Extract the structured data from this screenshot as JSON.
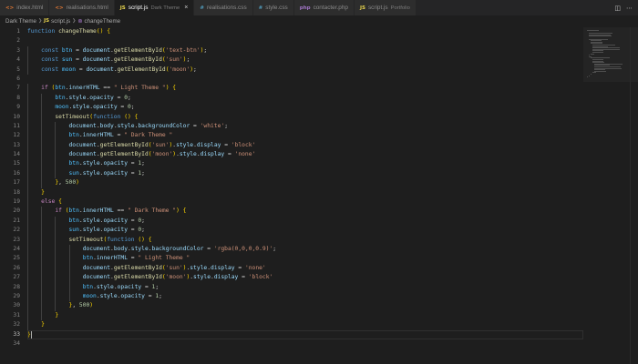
{
  "tabs": [
    {
      "label": "index.html",
      "icon": "html",
      "icon_text": "<>",
      "sub": "",
      "active": false
    },
    {
      "label": "realisations.html",
      "icon": "html",
      "icon_text": "<>",
      "sub": "",
      "active": false
    },
    {
      "label": "script.js",
      "icon": "js",
      "icon_text": "JS",
      "sub": "Dark Theme",
      "active": true
    },
    {
      "label": "realisations.css",
      "icon": "css",
      "icon_text": "#",
      "sub": "",
      "active": false
    },
    {
      "label": "style.css",
      "icon": "css",
      "icon_text": "#",
      "sub": "",
      "active": false
    },
    {
      "label": "contacter.php",
      "icon": "php",
      "icon_text": "php",
      "sub": "",
      "active": false
    },
    {
      "label": "script.js",
      "icon": "js",
      "icon_text": "JS",
      "sub": "Portfolio",
      "active": false
    }
  ],
  "tab_close": "×",
  "actions": [
    "split-editor-icon",
    "more-actions-icon"
  ],
  "breadcrumb": {
    "folder": "Dark Theme",
    "file_icon": "JS",
    "file": "script.js",
    "symbol_icon": "⊚",
    "symbol": "changeTheme"
  },
  "editor": {
    "active_line": 33,
    "lines": [
      {
        "n": 1,
        "indent": 0,
        "t": [
          [
            "kw",
            "function "
          ],
          [
            "fn",
            "changeTheme"
          ],
          [
            "br",
            "() {"
          ]
        ]
      },
      {
        "n": 2,
        "indent": 0,
        "t": []
      },
      {
        "n": 3,
        "indent": 1,
        "t": [
          [
            "kw",
            "const "
          ],
          [
            "con",
            "btn"
          ],
          [
            "pn",
            " = "
          ],
          [
            "var",
            "document"
          ],
          [
            "pn",
            "."
          ],
          [
            "fn",
            "getElementById"
          ],
          [
            "br",
            "("
          ],
          [
            "str",
            "'text-btn'"
          ],
          [
            "br",
            ")"
          ],
          [
            "pn",
            ";"
          ]
        ]
      },
      {
        "n": 4,
        "indent": 1,
        "t": [
          [
            "kw",
            "const "
          ],
          [
            "con",
            "sun"
          ],
          [
            "pn",
            " = "
          ],
          [
            "var",
            "document"
          ],
          [
            "pn",
            "."
          ],
          [
            "fn",
            "getElementById"
          ],
          [
            "br",
            "("
          ],
          [
            "str",
            "'sun'"
          ],
          [
            "br",
            ")"
          ],
          [
            "pn",
            ";"
          ]
        ]
      },
      {
        "n": 5,
        "indent": 1,
        "t": [
          [
            "kw",
            "const "
          ],
          [
            "con",
            "moon"
          ],
          [
            "pn",
            " = "
          ],
          [
            "var",
            "document"
          ],
          [
            "pn",
            "."
          ],
          [
            "fn",
            "getElementById"
          ],
          [
            "br",
            "("
          ],
          [
            "str",
            "'moon'"
          ],
          [
            "br",
            ")"
          ],
          [
            "pn",
            ";"
          ]
        ]
      },
      {
        "n": 6,
        "indent": 0,
        "t": []
      },
      {
        "n": 7,
        "indent": 1,
        "t": [
          [
            "ctl",
            "if "
          ],
          [
            "br",
            "("
          ],
          [
            "con",
            "btn"
          ],
          [
            "pn",
            "."
          ],
          [
            "var",
            "innerHTML"
          ],
          [
            "pn",
            " == "
          ],
          [
            "str",
            "\" Light Theme \""
          ],
          [
            "br",
            ")"
          ],
          [
            "pn",
            " "
          ],
          [
            "br",
            "{"
          ]
        ]
      },
      {
        "n": 8,
        "indent": 2,
        "t": [
          [
            "con",
            "btn"
          ],
          [
            "pn",
            "."
          ],
          [
            "var",
            "style"
          ],
          [
            "pn",
            "."
          ],
          [
            "var",
            "opacity"
          ],
          [
            "pn",
            " = "
          ],
          [
            "num",
            "0"
          ],
          [
            "pn",
            ";"
          ]
        ]
      },
      {
        "n": 9,
        "indent": 2,
        "t": [
          [
            "con",
            "moon"
          ],
          [
            "pn",
            "."
          ],
          [
            "var",
            "style"
          ],
          [
            "pn",
            "."
          ],
          [
            "var",
            "opacity"
          ],
          [
            "pn",
            " = "
          ],
          [
            "num",
            "0"
          ],
          [
            "pn",
            ";"
          ]
        ]
      },
      {
        "n": 10,
        "indent": 2,
        "t": [
          [
            "fn",
            "setTimeout"
          ],
          [
            "br",
            "("
          ],
          [
            "kw",
            "function "
          ],
          [
            "br",
            "() {"
          ]
        ]
      },
      {
        "n": 11,
        "indent": 3,
        "t": [
          [
            "var",
            "document"
          ],
          [
            "pn",
            "."
          ],
          [
            "var",
            "body"
          ],
          [
            "pn",
            "."
          ],
          [
            "var",
            "style"
          ],
          [
            "pn",
            "."
          ],
          [
            "var",
            "backgroundColor"
          ],
          [
            "pn",
            " = "
          ],
          [
            "str",
            "'white'"
          ],
          [
            "pn",
            ";"
          ]
        ]
      },
      {
        "n": 12,
        "indent": 3,
        "t": [
          [
            "con",
            "btn"
          ],
          [
            "pn",
            "."
          ],
          [
            "var",
            "innerHTML"
          ],
          [
            "pn",
            " = "
          ],
          [
            "str",
            "\" Dark Theme \""
          ]
        ]
      },
      {
        "n": 13,
        "indent": 3,
        "t": [
          [
            "var",
            "document"
          ],
          [
            "pn",
            "."
          ],
          [
            "fn",
            "getElementById"
          ],
          [
            "br",
            "("
          ],
          [
            "str",
            "'sun'"
          ],
          [
            "br",
            ")"
          ],
          [
            "pn",
            "."
          ],
          [
            "var",
            "style"
          ],
          [
            "pn",
            "."
          ],
          [
            "var",
            "display"
          ],
          [
            "pn",
            " = "
          ],
          [
            "str",
            "'block'"
          ]
        ]
      },
      {
        "n": 14,
        "indent": 3,
        "t": [
          [
            "var",
            "document"
          ],
          [
            "pn",
            "."
          ],
          [
            "fn",
            "getElementById"
          ],
          [
            "br",
            "("
          ],
          [
            "str",
            "'moon'"
          ],
          [
            "br",
            ")"
          ],
          [
            "pn",
            "."
          ],
          [
            "var",
            "style"
          ],
          [
            "pn",
            "."
          ],
          [
            "var",
            "display"
          ],
          [
            "pn",
            " = "
          ],
          [
            "str",
            "'none'"
          ]
        ]
      },
      {
        "n": 15,
        "indent": 3,
        "t": [
          [
            "con",
            "btn"
          ],
          [
            "pn",
            "."
          ],
          [
            "var",
            "style"
          ],
          [
            "pn",
            "."
          ],
          [
            "var",
            "opacity"
          ],
          [
            "pn",
            " = "
          ],
          [
            "num",
            "1"
          ],
          [
            "pn",
            ";"
          ]
        ]
      },
      {
        "n": 16,
        "indent": 3,
        "t": [
          [
            "con",
            "sun"
          ],
          [
            "pn",
            "."
          ],
          [
            "var",
            "style"
          ],
          [
            "pn",
            "."
          ],
          [
            "var",
            "opacity"
          ],
          [
            "pn",
            " = "
          ],
          [
            "num",
            "1"
          ],
          [
            "pn",
            ";"
          ]
        ]
      },
      {
        "n": 17,
        "indent": 2,
        "t": [
          [
            "br",
            "}"
          ],
          [
            "pn",
            ", "
          ],
          [
            "num",
            "500"
          ],
          [
            "br",
            ")"
          ]
        ]
      },
      {
        "n": 18,
        "indent": 1,
        "t": [
          [
            "br",
            "}"
          ]
        ]
      },
      {
        "n": 19,
        "indent": 1,
        "t": [
          [
            "ctl",
            "else "
          ],
          [
            "br",
            "{"
          ]
        ]
      },
      {
        "n": 20,
        "indent": 2,
        "t": [
          [
            "ctl",
            "if "
          ],
          [
            "br",
            "("
          ],
          [
            "con",
            "btn"
          ],
          [
            "pn",
            "."
          ],
          [
            "var",
            "innerHTML"
          ],
          [
            "pn",
            " == "
          ],
          [
            "str",
            "\" Dark Theme \""
          ],
          [
            "br",
            ")"
          ],
          [
            "pn",
            " "
          ],
          [
            "br",
            "{"
          ]
        ]
      },
      {
        "n": 21,
        "indent": 3,
        "t": [
          [
            "con",
            "btn"
          ],
          [
            "pn",
            "."
          ],
          [
            "var",
            "style"
          ],
          [
            "pn",
            "."
          ],
          [
            "var",
            "opacity"
          ],
          [
            "pn",
            " = "
          ],
          [
            "num",
            "0"
          ],
          [
            "pn",
            ";"
          ]
        ]
      },
      {
        "n": 22,
        "indent": 3,
        "t": [
          [
            "con",
            "sun"
          ],
          [
            "pn",
            "."
          ],
          [
            "var",
            "style"
          ],
          [
            "pn",
            "."
          ],
          [
            "var",
            "opacity"
          ],
          [
            "pn",
            " = "
          ],
          [
            "num",
            "0"
          ],
          [
            "pn",
            ";"
          ]
        ]
      },
      {
        "n": 23,
        "indent": 3,
        "t": [
          [
            "fn",
            "setTimeout"
          ],
          [
            "br",
            "("
          ],
          [
            "kw",
            "function "
          ],
          [
            "br",
            "() {"
          ]
        ]
      },
      {
        "n": 24,
        "indent": 4,
        "t": [
          [
            "var",
            "document"
          ],
          [
            "pn",
            "."
          ],
          [
            "var",
            "body"
          ],
          [
            "pn",
            "."
          ],
          [
            "var",
            "style"
          ],
          [
            "pn",
            "."
          ],
          [
            "var",
            "backgroundColor"
          ],
          [
            "pn",
            " = "
          ],
          [
            "str",
            "'rgba(0,0,0,0.9)'"
          ],
          [
            "pn",
            ";"
          ]
        ]
      },
      {
        "n": 25,
        "indent": 4,
        "t": [
          [
            "con",
            "btn"
          ],
          [
            "pn",
            "."
          ],
          [
            "var",
            "innerHTML"
          ],
          [
            "pn",
            " = "
          ],
          [
            "str",
            "\" Light Theme \""
          ]
        ]
      },
      {
        "n": 26,
        "indent": 4,
        "t": [
          [
            "var",
            "document"
          ],
          [
            "pn",
            "."
          ],
          [
            "fn",
            "getElementById"
          ],
          [
            "br",
            "("
          ],
          [
            "str",
            "'sun'"
          ],
          [
            "br",
            ")"
          ],
          [
            "pn",
            "."
          ],
          [
            "var",
            "style"
          ],
          [
            "pn",
            "."
          ],
          [
            "var",
            "display"
          ],
          [
            "pn",
            " = "
          ],
          [
            "str",
            "'none'"
          ]
        ]
      },
      {
        "n": 27,
        "indent": 4,
        "t": [
          [
            "var",
            "document"
          ],
          [
            "pn",
            "."
          ],
          [
            "fn",
            "getElementById"
          ],
          [
            "br",
            "("
          ],
          [
            "str",
            "'moon'"
          ],
          [
            "br",
            ")"
          ],
          [
            "pn",
            "."
          ],
          [
            "var",
            "style"
          ],
          [
            "pn",
            "."
          ],
          [
            "var",
            "display"
          ],
          [
            "pn",
            " = "
          ],
          [
            "str",
            "'block'"
          ]
        ]
      },
      {
        "n": 28,
        "indent": 4,
        "t": [
          [
            "con",
            "btn"
          ],
          [
            "pn",
            "."
          ],
          [
            "var",
            "style"
          ],
          [
            "pn",
            "."
          ],
          [
            "var",
            "opacity"
          ],
          [
            "pn",
            " = "
          ],
          [
            "num",
            "1"
          ],
          [
            "pn",
            ";"
          ]
        ]
      },
      {
        "n": 29,
        "indent": 4,
        "t": [
          [
            "con",
            "moon"
          ],
          [
            "pn",
            "."
          ],
          [
            "var",
            "style"
          ],
          [
            "pn",
            "."
          ],
          [
            "var",
            "opacity"
          ],
          [
            "pn",
            " = "
          ],
          [
            "num",
            "1"
          ],
          [
            "pn",
            ";"
          ]
        ]
      },
      {
        "n": 30,
        "indent": 3,
        "t": [
          [
            "br",
            "}"
          ],
          [
            "pn",
            ", "
          ],
          [
            "num",
            "500"
          ],
          [
            "br",
            ")"
          ]
        ]
      },
      {
        "n": 31,
        "indent": 2,
        "t": [
          [
            "br",
            "}"
          ]
        ]
      },
      {
        "n": 32,
        "indent": 1,
        "t": [
          [
            "br",
            "}"
          ]
        ]
      },
      {
        "n": 33,
        "indent": 0,
        "t": [
          [
            "br",
            "}"
          ]
        ]
      },
      {
        "n": 34,
        "indent": 0,
        "t": []
      }
    ]
  }
}
